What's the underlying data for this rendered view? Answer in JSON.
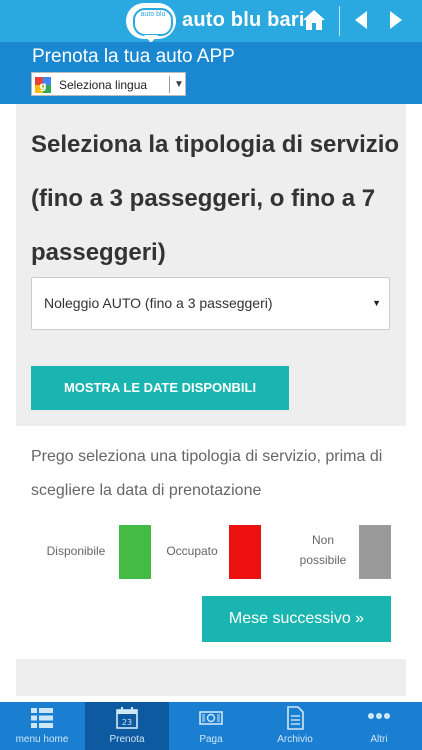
{
  "topbar": {
    "logo_text": "auto blu",
    "brand": "auto blu bari"
  },
  "header": {
    "title": "Prenota la tua auto APP",
    "language_select": "Seleziona lingua"
  },
  "form": {
    "heading": "Seleziona la tipologia di servizio (fino a 3 passeggeri, o fino a 7 passeggeri)",
    "service_select_value": "Noleggio AUTO (fino a 3 passeggeri)",
    "show_dates_button": "MOSTRA LE DATE DISPONBILI"
  },
  "calendar": {
    "info_text": "Prego seleziona una tipologia di servizio, prima di scegliere la data di prenotazione",
    "legend": [
      {
        "label": "Disponibile",
        "color": "#44bb44"
      },
      {
        "label": "Occupato",
        "color": "#ee1111"
      },
      {
        "label": "Non possibile",
        "color": "#999999"
      }
    ],
    "next_month_button": "Mese successivo »"
  },
  "colors": {
    "topbar": "#2aa8e0",
    "header": "#1a88d0",
    "accent_teal": "#1ab5b0",
    "bottom_nav": "#1a7fd0",
    "bottom_nav_active": "#0d5aa0"
  },
  "bottom_nav": [
    {
      "label": "menu home",
      "icon": "menu-grid-icon"
    },
    {
      "label": "Prenota",
      "icon": "calendar-icon",
      "active": true
    },
    {
      "label": "Paga",
      "icon": "money-icon"
    },
    {
      "label": "Archivio",
      "icon": "document-icon"
    },
    {
      "label": "Altri",
      "icon": "more-dots-icon"
    }
  ]
}
